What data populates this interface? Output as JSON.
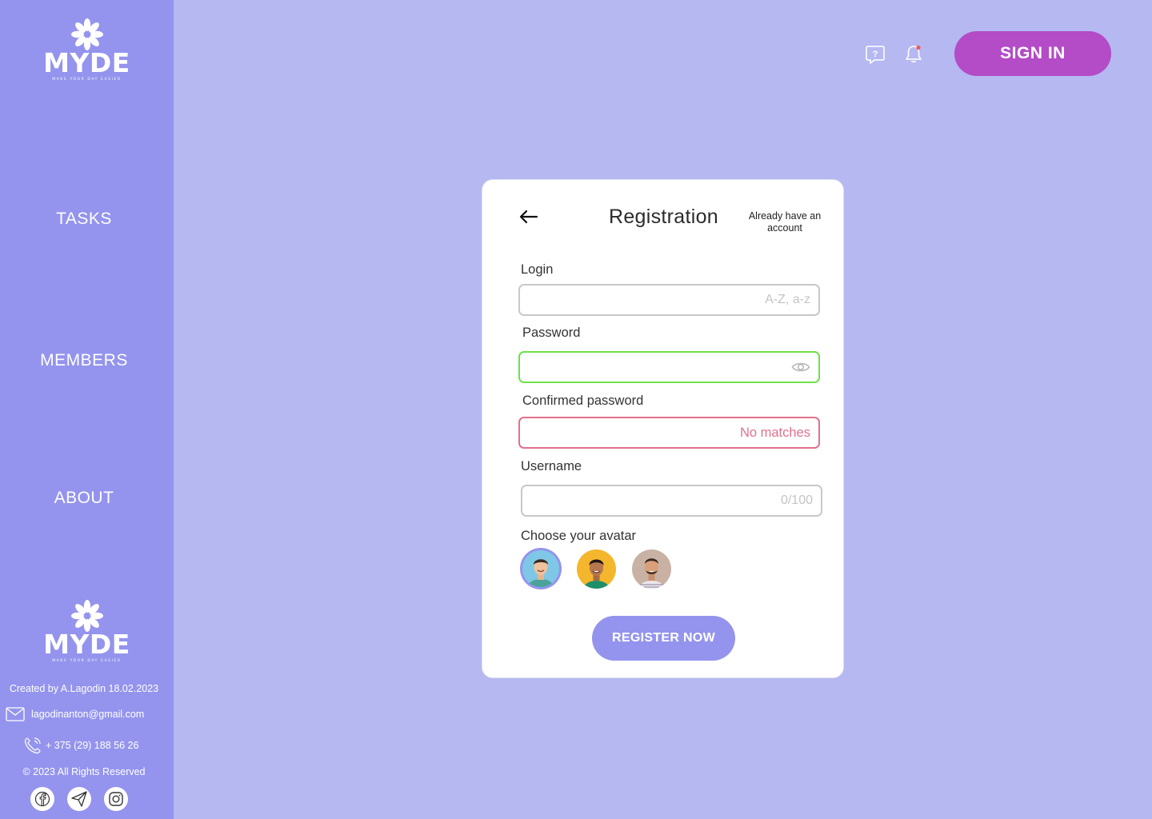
{
  "brand": {
    "name": "MYDE",
    "tagline": "MAKE YOUR DAY EASIER"
  },
  "sidebar": {
    "items": [
      {
        "label": "TASKS"
      },
      {
        "label": "MEMBERS"
      },
      {
        "label": "ABOUT"
      }
    ],
    "footer": {
      "created": "Created by A.Lagodin 18.02.2023",
      "email": "lagodinanton@gmail.com",
      "phone": "+ 375 (29) 188 56 26",
      "rights": "© 2023 All Rights Reserved",
      "socials": [
        "facebook-icon",
        "telegram-icon",
        "instagram-icon"
      ]
    }
  },
  "header": {
    "signin_label": "SIGN IN",
    "icons": [
      "help-chat-icon",
      "bell-icon"
    ],
    "notification_dot_color": "#f05a5a"
  },
  "registration": {
    "title": "Registration",
    "already_account": "Already have an account",
    "fields": {
      "login": {
        "label": "Login",
        "hint": "A-Z, a-z",
        "value": ""
      },
      "password": {
        "label": "Password",
        "value": "",
        "state_color": "#6fe04a"
      },
      "confirm": {
        "label": "Confirmed password",
        "hint": "No matches",
        "value": "",
        "state_color": "#e0718b"
      },
      "username": {
        "label": "Username",
        "hint": "0/100",
        "value": ""
      }
    },
    "avatar_label": "Choose your avatar",
    "avatars": [
      {
        "name": "avatar-1",
        "bg": "#7fc7e6",
        "selected": true
      },
      {
        "name": "avatar-2",
        "bg": "#f4b62d",
        "selected": false
      },
      {
        "name": "avatar-3",
        "bg": "#c9b2a4",
        "selected": false
      }
    ],
    "submit_label": "REGISTER NOW"
  },
  "colors": {
    "page_bg": "#b5b8f1",
    "sidebar_bg": "#9494ee",
    "signin_bg": "#b44bc7",
    "register_bg": "#9494ee"
  }
}
